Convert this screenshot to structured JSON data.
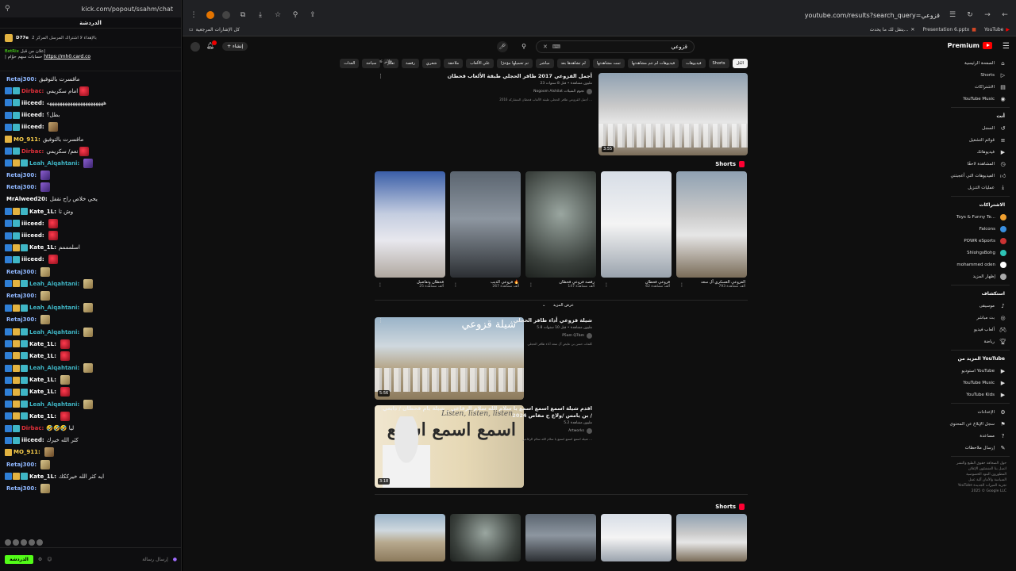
{
  "chat": {
    "url": "kick.com/popout/ssahm/chat",
    "title": "الدردشة",
    "pinned_count": "D77e",
    "pinned_text": "بالإهداء لا اشتراك المرسل المركز 2",
    "bot_name": "BotRix",
    "bot_label": "إعلان من قبل",
    "bot_link": "https://mh0.card.co",
    "bot_text": "| حسابات سهم حوّام",
    "messages": [
      {
        "user": "Retaj300:",
        "color": "#8fb7ff",
        "text": "ماقسرت بالتوفيق",
        "badges": [],
        "emote": ""
      },
      {
        "user": "Dirbac:",
        "color": "#e0303a",
        "text": "امام سكريمي",
        "badges": [
          "blue",
          "teal"
        ],
        "emote": "em-rose"
      },
      {
        "user": "iiiceed:",
        "color": "#ffffff",
        "text": "ههههههههههههههههههههههه",
        "badges": [
          "blue",
          "teal"
        ],
        "emote": ""
      },
      {
        "user": "iiiceed:",
        "color": "#ffffff",
        "text": "بطل؟",
        "badges": [
          "blue",
          "teal"
        ],
        "emote": ""
      },
      {
        "user": "iiiceed:",
        "color": "#ffffff",
        "text": "",
        "badges": [
          "blue",
          "teal"
        ],
        "emote": "em-face"
      },
      {
        "user": "MO_911:",
        "color": "#ffd34d",
        "text": "ماقسرت بالتوفيق",
        "badges": [
          "gold"
        ],
        "emote": ""
      },
      {
        "user": "Dirbac:",
        "color": "#e0303a",
        "text": "نعم/ سكريمي",
        "badges": [
          "blue",
          "teal"
        ],
        "emote": "em-rose"
      },
      {
        "user": "Leah_Alqahtani:",
        "color": "#3fb6c6",
        "text": "",
        "badges": [
          "blue",
          "gold",
          "teal"
        ],
        "emote": "em-purple"
      },
      {
        "user": "Retaj300:",
        "color": "#8fb7ff",
        "text": "",
        "badges": [],
        "emote": "em-purple"
      },
      {
        "user": "Retaj300:",
        "color": "#8fb7ff",
        "text": "",
        "badges": [],
        "emote": "em-purple"
      },
      {
        "user": "MrAlweed20:",
        "color": "#ffffff",
        "text": "يحي خلاص راح نقفل",
        "badges": [],
        "emote": ""
      },
      {
        "user": "Kate_1L:",
        "color": "#ffffff",
        "text": "وش تا",
        "badges": [
          "blue",
          "gold",
          "teal"
        ],
        "emote": ""
      },
      {
        "user": "iiiceed:",
        "color": "#ffffff",
        "text": "",
        "badges": [
          "blue",
          "teal"
        ],
        "emote": "em-rose"
      },
      {
        "user": "iiiceed:",
        "color": "#ffffff",
        "text": "",
        "badges": [
          "blue",
          "teal"
        ],
        "emote": "em-rose"
      },
      {
        "user": "Kate_1L:",
        "color": "#ffffff",
        "text": "اسلمممم",
        "badges": [
          "blue",
          "gold",
          "teal"
        ],
        "emote": ""
      },
      {
        "user": "iiiceed:",
        "color": "#ffffff",
        "text": "",
        "badges": [
          "blue",
          "teal"
        ],
        "emote": "em-rose"
      },
      {
        "user": "Retaj300:",
        "color": "#8fb7ff",
        "text": "",
        "badges": [],
        "emote": "em-tan"
      },
      {
        "user": "Leah_Alqahtani:",
        "color": "#3fb6c6",
        "text": "",
        "badges": [
          "blue",
          "gold",
          "teal"
        ],
        "emote": "em-tan"
      },
      {
        "user": "Retaj300:",
        "color": "#8fb7ff",
        "text": "",
        "badges": [],
        "emote": "em-tan"
      },
      {
        "user": "Leah_Alqahtani:",
        "color": "#3fb6c6",
        "text": "",
        "badges": [
          "blue",
          "gold",
          "teal"
        ],
        "emote": "em-tan"
      },
      {
        "user": "Retaj300:",
        "color": "#8fb7ff",
        "text": "",
        "badges": [],
        "emote": "em-tan"
      },
      {
        "user": "Leah_Alqahtani:",
        "color": "#3fb6c6",
        "text": "",
        "badges": [
          "blue",
          "gold",
          "teal"
        ],
        "emote": "em-tan"
      },
      {
        "user": "Kate_1L:",
        "color": "#ffffff",
        "text": "",
        "badges": [
          "blue",
          "gold",
          "teal"
        ],
        "emote": "em-rose"
      },
      {
        "user": "Kate_1L:",
        "color": "#ffffff",
        "text": "",
        "badges": [
          "blue",
          "gold",
          "teal"
        ],
        "emote": "em-rose"
      },
      {
        "user": "Leah_Alqahtani:",
        "color": "#3fb6c6",
        "text": "",
        "badges": [
          "blue",
          "gold",
          "teal"
        ],
        "emote": "em-tan"
      },
      {
        "user": "Kate_1L:",
        "color": "#ffffff",
        "text": "",
        "badges": [
          "blue",
          "gold",
          "teal"
        ],
        "emote": "em-tan"
      },
      {
        "user": "Kate_1L:",
        "color": "#ffffff",
        "text": "",
        "badges": [
          "blue",
          "gold",
          "teal"
        ],
        "emote": "em-rose"
      },
      {
        "user": "Leah_Alqahtani:",
        "color": "#3fb6c6",
        "text": "",
        "badges": [
          "blue",
          "gold",
          "teal"
        ],
        "emote": "em-tan"
      },
      {
        "user": "Kate_1L:",
        "color": "#ffffff",
        "text": "",
        "badges": [
          "blue",
          "gold",
          "teal"
        ],
        "emote": "em-rose"
      },
      {
        "user": "Dirbac:",
        "color": "#e0303a",
        "text": "🤣🤣🤣 ليا",
        "badges": [
          "blue",
          "teal"
        ],
        "emote": ""
      },
      {
        "user": "iiiceed:",
        "color": "#ffffff",
        "text": "كثر الله خيرك",
        "badges": [
          "blue",
          "teal"
        ],
        "emote": ""
      },
      {
        "user": "MO_911:",
        "color": "#ffd34d",
        "text": "",
        "badges": [
          "gold"
        ],
        "emote": "em-face"
      },
      {
        "user": "Retaj300:",
        "color": "#8fb7ff",
        "text": "",
        "badges": [],
        "emote": "em-tan"
      },
      {
        "user": "Kate_1L:",
        "color": "#ffffff",
        "text": "ايه كثر الله خيرككك",
        "badges": [
          "blue",
          "gold",
          "teal"
        ],
        "emote": ""
      },
      {
        "user": "Retaj300:",
        "color": "#8fb7ff",
        "text": "",
        "badges": [],
        "emote": "em-tan"
      }
    ],
    "input_placeholder": "إرسال رسالة",
    "send_label": "الدردشة"
  },
  "browser": {
    "url": "youtube.com/results?search_query=قزوعي",
    "tabs": [
      "Presentation 6.pptx",
      "YouTube"
    ],
    "bookmarks": {
      "all_label": "كل الإشارات المرجعية",
      "item1": "Presentation 6.pptx",
      "item2": "يتقل لك ما يحدث...",
      "item3": "YouTube"
    }
  },
  "yt": {
    "premium_label": "Premium",
    "search_query": "قزوعي",
    "create_label": "إنشاء",
    "filter_label": "فلاتر",
    "chips": [
      "الكل",
      "Shorts",
      "فيديوهات",
      "فيديوهات لم تتم مشاهدتها",
      "تمت مشاهدتها",
      "لم تشاهدها بعد",
      "مباشر",
      "تم تحميلها مؤخرًا",
      "علي الألعاب",
      "ملاحقة",
      "شعري",
      "رقصة",
      "تعلم",
      "سياحة",
      "العدات"
    ],
    "video1": {
      "title": "أجمل القزوعي 2017 ظافر الحجلي طبقة الألعاب قحطان",
      "meta": "23 مليون مشاهدة • قبل 8 سنوات",
      "channel": "Nogoom Alshilat نجوم الشيلات",
      "desc": "أجمل القزوعي ظافر الحجلي طبقة الألعاب قحطان المشاركة 2016 ...",
      "duration": "3:55"
    },
    "shorts_title": "Shorts",
    "shorts": [
      {
        "title": "القزوعي العسكري آل سعد",
        "views": "793 ألف مشاهدة"
      },
      {
        "title": "قزوعي قحطان",
        "views": "62 ألف مشاهدة"
      },
      {
        "title": "رقصة قزوعي قحطان",
        "views": "147 ألف مشاهدة"
      },
      {
        "title": "قزوعي الذيب 🔥",
        "views": "267 ألف مشاهدة"
      },
      {
        "title": "قحطان وتفاصيل",
        "views": "25 ألف مشاهدة"
      }
    ],
    "show_more": "عرض المزيد",
    "video2": {
      "title": "شيلة قزوعي أداء ظافر الحجلي",
      "meta": "5.8 مليون مشاهدة • قبل 10 سنوات",
      "channel": "P5am Q7bm",
      "desc": "كلمات حسن بن عايض آل سعد أداء ظافر الحجلي",
      "duration": "5:56",
      "thumb_title": "شيلة قزوعي"
    },
    "video3": {
      "title": "اقدم شيلة اسمع اسمع اسمع يا سلام الله سلام الرقاعي _ شيلة يام قحطان / دابعي بن يامس /ولاع ح مقاص 2024 /",
      "meta": "5.2 مليون مشاهدة",
      "channel": "Artworks",
      "desc": "شيلة اسمع اسمع اسمع يا سلام الله سلام الرقاعي ...",
      "duration": "3:18",
      "poster_main": "اسمع اسمع اسمع",
      "poster_sub": "Listen, listen, listen"
    },
    "sidebar": {
      "main": [
        "الصفحة الرئيسية",
        "Shorts",
        "الاشتراكات",
        "YouTube Music"
      ],
      "you_head": "أنت",
      "you": [
        "السجل",
        "قوائم التشغيل",
        "فيديوهاتك",
        "المشاهدة لاحقًا",
        "الفيديوهات التي أعجبتني",
        "عمليات التنزيل"
      ],
      "subs_head": "الاشتراكات",
      "subs": [
        "Toys & Funny Te...",
        "Falcons",
        "POWR eSports",
        "ShlohgsBohg",
        "mohammed oden",
        "إظهار المزيد"
      ],
      "explore_head": "استكشاف",
      "explore": [
        "موسيقى",
        "بث مباشر",
        "ألعاب فيديو",
        "رياضة"
      ],
      "more_head": "المزيد من YouTube",
      "more": [
        "استوديو YouTube",
        "YouTube Music",
        "YouTube Kids"
      ],
      "settings": [
        "الإعدادات",
        "سجل الإبلاغ عن المحتوى",
        "مساعدة",
        "إرسال ملاحظات"
      ],
      "footer": "حول الصحافة حقوق الطبع والنشر اتصل بنا المنشئون الإعلان المطورون البنود الخصوصية السياسة والأمان آلية عمل YouTube تجربة الميزات الجديدة © 2025 Google LLC"
    }
  }
}
